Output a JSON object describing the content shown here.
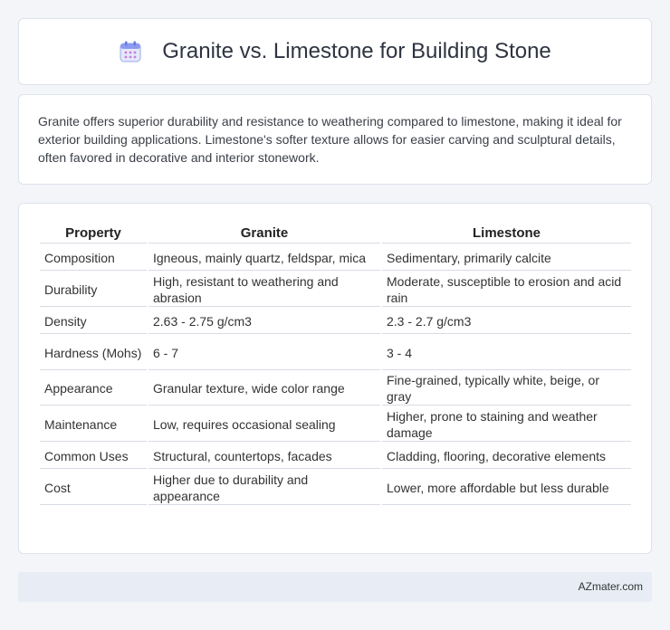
{
  "header": {
    "icon": "calendar-icon",
    "title": "Granite vs. Limestone for Building Stone"
  },
  "summary": "Granite offers superior durability and resistance to weathering compared to limestone, making it ideal for exterior building applications. Limestone's softer texture allows for easier carving and sculptural details, often favored in decorative and interior stonework.",
  "table": {
    "headers": [
      "Property",
      "Granite",
      "Limestone"
    ],
    "rows": [
      [
        "Composition",
        "Igneous, mainly quartz, feldspar, mica",
        "Sedimentary, primarily calcite"
      ],
      [
        "Durability",
        "High, resistant to weathering and abrasion",
        "Moderate, susceptible to erosion and acid rain"
      ],
      [
        "Density",
        "2.63 - 2.75 g/cm3",
        "2.3 - 2.7 g/cm3"
      ],
      [
        "Hardness (Mohs)",
        "6 - 7",
        "3 - 4"
      ],
      [
        "Appearance",
        "Granular texture, wide color range",
        "Fine-grained, typically white, beige, or gray"
      ],
      [
        "Maintenance",
        "Low, requires occasional sealing",
        "Higher, prone to staining and weather damage"
      ],
      [
        "Common Uses",
        "Structural, countertops, facades",
        "Cladding, flooring, decorative elements"
      ],
      [
        "Cost",
        "Higher due to durability and appearance",
        "Lower, more affordable but less durable"
      ]
    ]
  },
  "footer": {
    "credit": "AZmater.com"
  }
}
